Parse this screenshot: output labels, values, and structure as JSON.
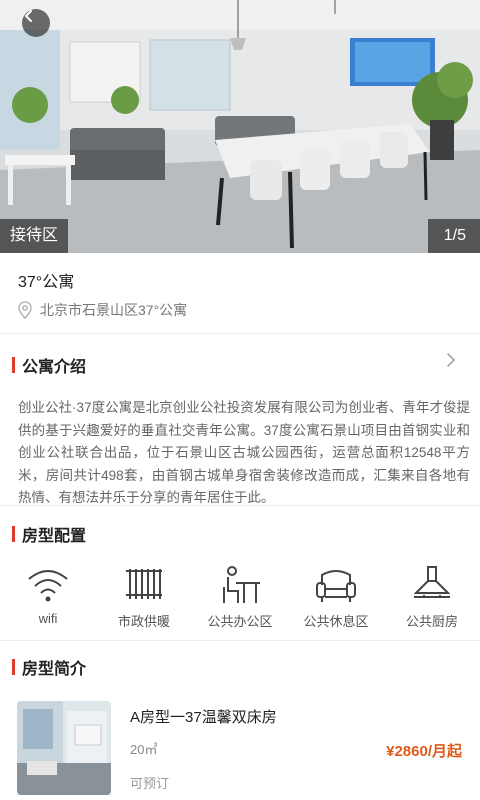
{
  "hero": {
    "room_label": "接待区",
    "page_counter": "1/5"
  },
  "apartment": {
    "title": "37°公寓",
    "address": "北京市石景山区37°公寓"
  },
  "intro_section": {
    "title": "公寓介绍",
    "text": "创业公社·37度公寓是北京创业公社投资发展有限公司为创业者、青年才俊提供的基于兴趣爱好的垂直社交青年公寓。37度公寓石景山项目由首钢实业和创业公社联合出品，位于石景山区古城公园西街，运营总面积12548平方米，房间共计498套，由首钢古城单身宿舍装修改造而成，汇集来自各地有热情、有想法并乐于分享的青年居住于此。"
  },
  "config_section": {
    "title": "房型配置",
    "amenities": [
      {
        "label": "wifi",
        "icon": "wifi-icon"
      },
      {
        "label": "市政供暖",
        "icon": "radiator-icon"
      },
      {
        "label": "公共办公区",
        "icon": "desk-icon"
      },
      {
        "label": "公共休息区",
        "icon": "sofa-icon"
      },
      {
        "label": "公共厨房",
        "icon": "range-hood-icon"
      }
    ]
  },
  "rooms_section": {
    "title": "房型简介",
    "rooms": [
      {
        "name": "A房型一37温馨双床房",
        "area": "20㎡",
        "price": "¥2860/月起",
        "status": "可预订"
      }
    ]
  },
  "colors": {
    "accent": "#e03a2f",
    "price": "#e05a1a"
  }
}
